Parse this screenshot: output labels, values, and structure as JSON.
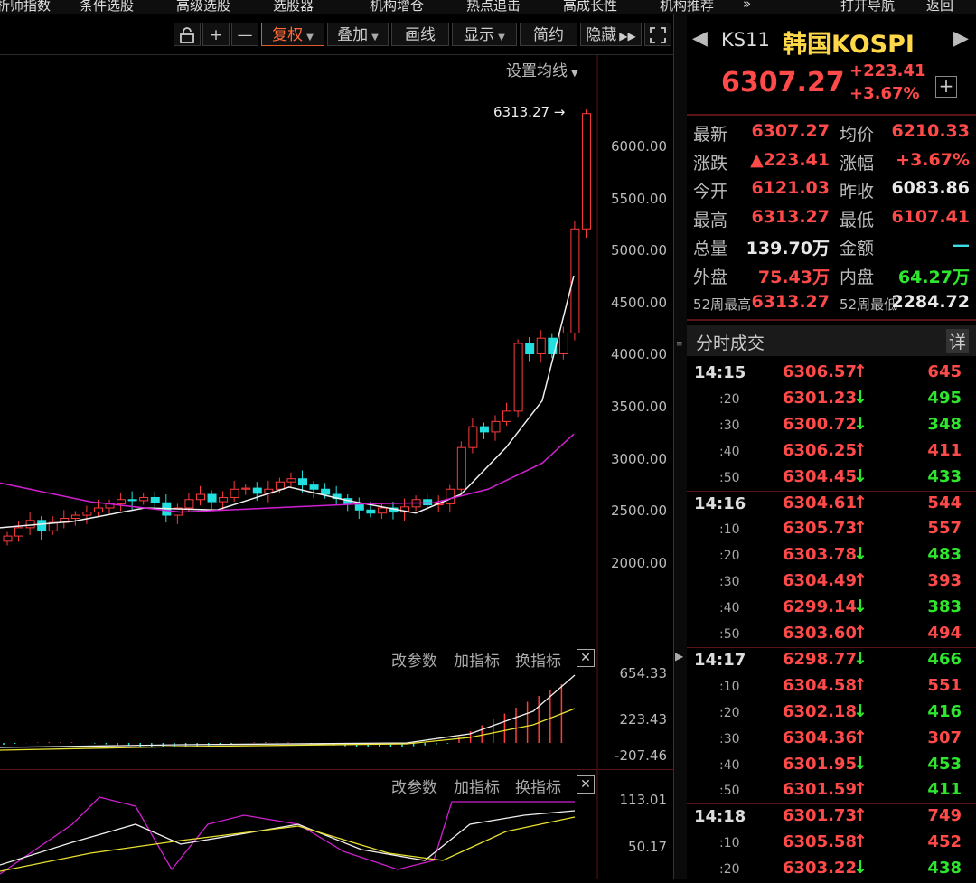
{
  "top_nav": [
    "析师指数",
    "条件选股",
    "高级选股",
    "选股器",
    "机构增仓",
    "热点追击",
    "高成长性",
    "机构推荐",
    "»",
    "打开导航",
    "返回"
  ],
  "toolbar": {
    "lock_icon": "lock-icon",
    "plus_label": "+",
    "minus_label": "—",
    "fuquan_label": "复权",
    "overlay_label": "叠加",
    "draw_label": "画线",
    "display_label": "显示",
    "simple_label": "简约",
    "hide_label": "隐藏",
    "fullscreen_icon": "fullscreen-icon"
  },
  "main_chart": {
    "ma_setting": "设置均线",
    "high_marker": "6313.27",
    "yaxis": [
      "6000.00",
      "5500.00",
      "5000.00",
      "4500.00",
      "4000.00",
      "3500.00",
      "3000.00",
      "2500.00",
      "2000.00"
    ]
  },
  "indicator1": {
    "change_params": "改参数",
    "add_indicator": "加指标",
    "swap_indicator": "换指标",
    "yaxis": [
      "654.33",
      "223.43",
      "-207.46"
    ]
  },
  "indicator2": {
    "change_params": "改参数",
    "add_indicator": "加指标",
    "swap_indicator": "换指标",
    "yaxis": [
      "113.01",
      "50.17"
    ]
  },
  "quote": {
    "code": "KS11",
    "name": "韩国KOSPI",
    "price": "6307.27",
    "change": "+223.41",
    "change_pct": "+3.67%",
    "fields": [
      {
        "l1": "最新",
        "v1": "6307.27",
        "c1": "red",
        "l2": "均价",
        "v2": "6210.33",
        "c2": "red"
      },
      {
        "l1": "涨跌",
        "v1": "▲223.41",
        "c1": "red",
        "l2": "涨幅",
        "v2": "+3.67%",
        "c2": "red"
      },
      {
        "l1": "今开",
        "v1": "6121.03",
        "c1": "red",
        "l2": "昨收",
        "v2": "6083.86",
        "c2": "white"
      },
      {
        "l1": "最高",
        "v1": "6313.27",
        "c1": "red",
        "l2": "最低",
        "v2": "6107.41",
        "c2": "red"
      },
      {
        "l1": "总量",
        "v1": "139.70万",
        "c1": "white",
        "l2": "金额",
        "v2": "—",
        "c2": "cyan"
      },
      {
        "l1": "外盘",
        "v1": "75.43万",
        "c1": "red",
        "l2": "内盘",
        "v2": "64.27万",
        "c2": "green"
      },
      {
        "l1": "52周最高",
        "v1": "6313.27",
        "c1": "red",
        "l2": "52周最低",
        "v2": "2284.72",
        "c2": "white"
      }
    ]
  },
  "ticks_header": {
    "title": "分时成交",
    "detail": "详"
  },
  "ticks": [
    {
      "t": "14:15",
      "p": "6306.57",
      "d": "up",
      "v": "645",
      "vc": "red"
    },
    {
      "t": ":20",
      "p": "6301.23",
      "d": "down",
      "v": "495",
      "vc": "green"
    },
    {
      "t": ":30",
      "p": "6300.72",
      "d": "down",
      "v": "348",
      "vc": "green"
    },
    {
      "t": ":40",
      "p": "6306.25",
      "d": "up",
      "v": "411",
      "vc": "red"
    },
    {
      "t": ":50",
      "p": "6304.45",
      "d": "down",
      "v": "433",
      "vc": "green"
    },
    {
      "t": "14:16",
      "p": "6304.61",
      "d": "up",
      "v": "544",
      "vc": "red"
    },
    {
      "t": ":10",
      "p": "6305.73",
      "d": "up",
      "v": "557",
      "vc": "red"
    },
    {
      "t": ":20",
      "p": "6303.78",
      "d": "down",
      "v": "483",
      "vc": "green"
    },
    {
      "t": ":30",
      "p": "6304.49",
      "d": "up",
      "v": "393",
      "vc": "red"
    },
    {
      "t": ":40",
      "p": "6299.14",
      "d": "down",
      "v": "383",
      "vc": "green"
    },
    {
      "t": ":50",
      "p": "6303.60",
      "d": "up",
      "v": "494",
      "vc": "red"
    },
    {
      "t": "14:17",
      "p": "6298.77",
      "d": "down",
      "v": "466",
      "vc": "green"
    },
    {
      "t": ":10",
      "p": "6304.58",
      "d": "up",
      "v": "551",
      "vc": "red"
    },
    {
      "t": ":20",
      "p": "6302.18",
      "d": "down",
      "v": "416",
      "vc": "green"
    },
    {
      "t": ":30",
      "p": "6304.36",
      "d": "up",
      "v": "307",
      "vc": "red"
    },
    {
      "t": ":40",
      "p": "6301.95",
      "d": "down",
      "v": "453",
      "vc": "green"
    },
    {
      "t": ":50",
      "p": "6301.59",
      "d": "up",
      "v": "411",
      "vc": "green"
    },
    {
      "t": "14:18",
      "p": "6301.73",
      "d": "up",
      "v": "749",
      "vc": "red"
    },
    {
      "t": ":10",
      "p": "6305.58",
      "d": "up",
      "v": "452",
      "vc": "red"
    },
    {
      "t": ":20",
      "p": "6303.22",
      "d": "down",
      "v": "438",
      "vc": "green"
    }
  ],
  "colors": {
    "up": "#ff3b3b",
    "down": "#22e0e0",
    "ma_white": "#f0f0f0",
    "ma_magenta": "#d020d0",
    "ma_yellow": "#e8e030"
  }
}
